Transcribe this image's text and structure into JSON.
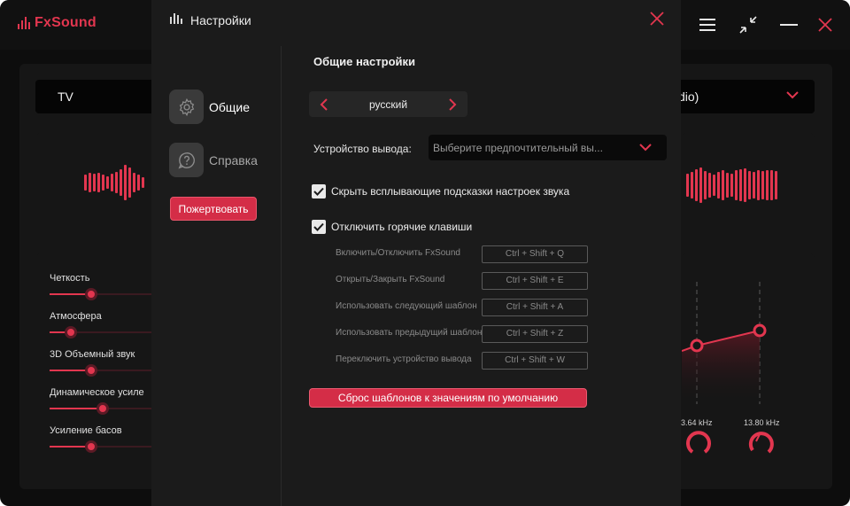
{
  "app": {
    "logo_text": "FxSound",
    "preset": "TV",
    "device_partial": "dio)",
    "effects": [
      {
        "label": "Четкость",
        "level": 0.38
      },
      {
        "label": "Атмосфера",
        "level": 0.2
      },
      {
        "label": "3D Объемный звук",
        "level": 0.38
      },
      {
        "label": "Динамическое усиле",
        "level": 0.5
      },
      {
        "label": "Усиление басов",
        "level": 0.38
      }
    ],
    "eq_freqs": [
      "3.64 kHz",
      "13.80 kHz"
    ]
  },
  "dialog": {
    "title": "Настройки",
    "nav": [
      {
        "label": "Общие",
        "icon": "gear-icon"
      },
      {
        "label": "Справка",
        "icon": "help-icon"
      }
    ],
    "donate_label": "Пожертвовать",
    "section_title": "Общие настройки",
    "language": "русский",
    "output_label": "Устройство вывода:",
    "output_placeholder": "Выберите предпочтительный вы...",
    "hide_tips_label": "Скрыть всплывающие подсказки настроек звука",
    "hide_tips_checked": true,
    "disable_hotkeys_label": "Отключить горячие клавиши",
    "disable_hotkeys_checked": true,
    "hotkeys": [
      {
        "label": "Включить/Отключить FxSound",
        "keys": "Ctrl +  Shift + Q"
      },
      {
        "label": "Открыть/Закрыть FxSound",
        "keys": "Ctrl +  Shift + E"
      },
      {
        "label": "Использовать следующий шаблон",
        "keys": "Ctrl +  Shift + A"
      },
      {
        "label": "Использовать предыдущий шаблон",
        "keys": "Ctrl +  Shift + Z"
      },
      {
        "label": "Переключить устройство вывода",
        "keys": "Ctrl +  Shift + W"
      }
    ],
    "reset_label": "Сброс шаблонов к значениям по умолчанию"
  },
  "colors": {
    "accent": "#e2364f",
    "dialog_bg": "#1b1b1b",
    "app_bg": "#0d0d0d"
  }
}
